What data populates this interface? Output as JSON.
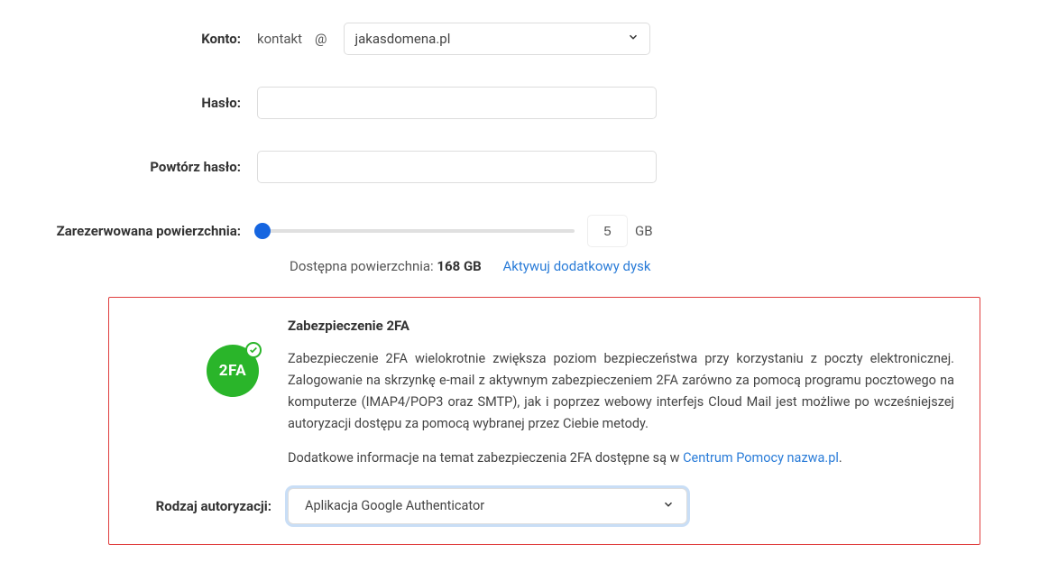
{
  "fields": {
    "account_label": "Konto:",
    "account_user": "kontakt",
    "account_at": "@",
    "account_domain": "jakasdomena.pl",
    "password_label": "Hasło:",
    "password_value": "",
    "repeat_password_label": "Powtórz hasło:",
    "repeat_password_value": "",
    "reserved_label": "Zarezerwowana powierzchnia:",
    "reserved_value": "5",
    "reserved_unit": "GB",
    "available_prefix": "Dostępna powierzchnia: ",
    "available_value": "168 GB",
    "activate_link": "Aktywuj dodatkowy dysk"
  },
  "twofa": {
    "badge_text": "2FA",
    "title": "Zabezpieczenie 2FA",
    "description": "Zabezpieczenie 2FA wielokrotnie zwiększa poziom bezpieczeństwa przy korzystaniu z poczty elektronicznej. Zalogowanie na skrzynkę e‑mail z aktywnym zabezpieczeniem 2FA zarówno za pomocą programu pocztowego na komputerze (IMAP4/POP3 oraz SMTP), jak i poprzez webowy interfejs Cloud Mail jest możliwe po wcześniejszej autoryzacji dostępu za pomocą wybranej przez Ciebie metody.",
    "more_prefix": "Dodatkowe informacje na temat zabezpieczenia 2FA dostępne są w ",
    "more_link": "Centrum Pomocy nazwa.pl",
    "more_suffix": ".",
    "auth_label": "Rodzaj autoryzacji:",
    "auth_selected": "Aplikacja Google Authenticator"
  }
}
